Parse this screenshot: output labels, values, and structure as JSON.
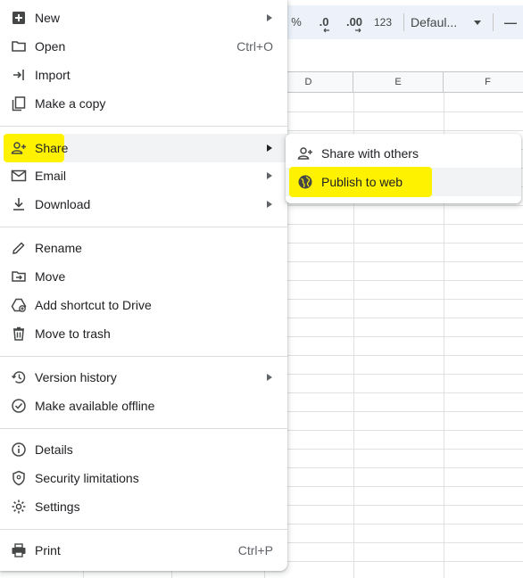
{
  "toolbar": {
    "percent": "%",
    "decrease_decimal": ".0",
    "increase_decimal": ".00",
    "number_format": "123",
    "font_name": "Defaul...",
    "zoom_minus": "—"
  },
  "grid": {
    "columns": [
      "D",
      "E",
      "F"
    ]
  },
  "file_menu": {
    "items": [
      {
        "label": "New",
        "shortcut": "",
        "submenu": true
      },
      {
        "label": "Open",
        "shortcut": "Ctrl+O",
        "submenu": false
      },
      {
        "label": "Import",
        "shortcut": "",
        "submenu": false
      },
      {
        "label": "Make a copy",
        "shortcut": "",
        "submenu": false
      },
      {
        "label": "Share",
        "shortcut": "",
        "submenu": true
      },
      {
        "label": "Email",
        "shortcut": "",
        "submenu": true
      },
      {
        "label": "Download",
        "shortcut": "",
        "submenu": true
      },
      {
        "label": "Rename",
        "shortcut": "",
        "submenu": false
      },
      {
        "label": "Move",
        "shortcut": "",
        "submenu": false
      },
      {
        "label": "Add shortcut to Drive",
        "shortcut": "",
        "submenu": false
      },
      {
        "label": "Move to trash",
        "shortcut": "",
        "submenu": false
      },
      {
        "label": "Version history",
        "shortcut": "",
        "submenu": true
      },
      {
        "label": "Make available offline",
        "shortcut": "",
        "submenu": false
      },
      {
        "label": "Details",
        "shortcut": "",
        "submenu": false
      },
      {
        "label": "Security limitations",
        "shortcut": "",
        "submenu": false
      },
      {
        "label": "Settings",
        "shortcut": "",
        "submenu": false
      },
      {
        "label": "Print",
        "shortcut": "Ctrl+P",
        "submenu": false
      }
    ]
  },
  "share_submenu": {
    "items": [
      {
        "label": "Share with others"
      },
      {
        "label": "Publish to web"
      }
    ]
  },
  "colors": {
    "highlight": "#fff200",
    "hover": "#f1f3f4",
    "icon": "#444746"
  }
}
